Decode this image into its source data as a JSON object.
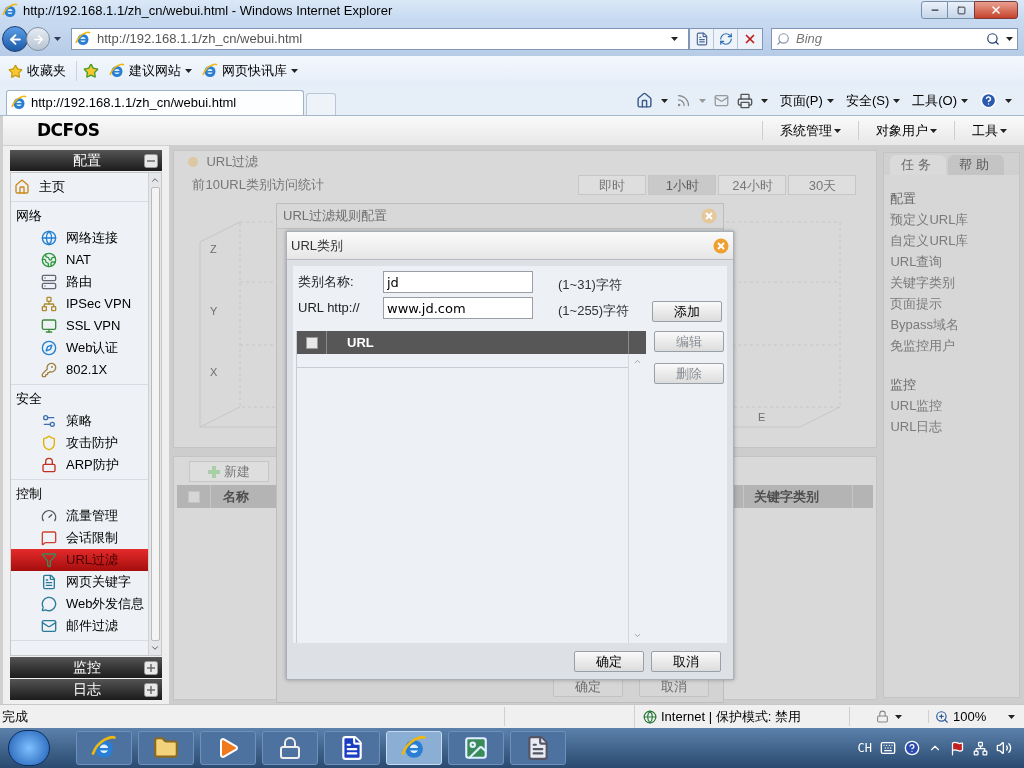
{
  "browser": {
    "title": "http://192.168.1.1/zh_cn/webui.html - Windows Internet Explorer",
    "address": "http://192.168.1.1/zh_cn/webui.html",
    "search_placeholder": "Bing",
    "favorites_label": "收藏夹",
    "favorites": [
      "建议网站",
      "网页快讯库"
    ],
    "tabs": [
      {
        "label": "http://192.168.1.1/zh_cn/webui.html",
        "selected": true
      }
    ],
    "commands": [
      "页面(P)",
      "安全(S)",
      "工具(O)"
    ]
  },
  "app": {
    "logo": "DCFOS",
    "menu": [
      "系统管理",
      "对象用户",
      "工具"
    ]
  },
  "sidebar": {
    "sections": [
      {
        "title": "配置",
        "expanded": true,
        "groups": [
          {
            "items": [
              {
                "label": "主页",
                "selected": false
              }
            ]
          },
          {
            "heading": "网络",
            "items": [
              {
                "label": "网络连接",
                "selected": false
              },
              {
                "label": "NAT",
                "selected": false
              },
              {
                "label": "路由",
                "selected": false
              },
              {
                "label": "IPSec VPN",
                "selected": false
              },
              {
                "label": "SSL VPN",
                "selected": false
              },
              {
                "label": "Web认证",
                "selected": false
              },
              {
                "label": "802.1X",
                "selected": false
              }
            ]
          },
          {
            "heading": "安全",
            "items": [
              {
                "label": "策略",
                "selected": false
              },
              {
                "label": "攻击防护",
                "selected": false
              },
              {
                "label": "ARP防护",
                "selected": false
              }
            ]
          },
          {
            "heading": "控制",
            "items": [
              {
                "label": "流量管理",
                "selected": false
              },
              {
                "label": "会话限制",
                "selected": false
              },
              {
                "label": "URL过滤",
                "selected": true
              },
              {
                "label": "网页关键字",
                "selected": false
              },
              {
                "label": "Web外发信息",
                "selected": false
              },
              {
                "label": "邮件过滤",
                "selected": false
              }
            ]
          }
        ]
      },
      {
        "title": "监控",
        "expanded": false
      },
      {
        "title": "日志",
        "expanded": false
      }
    ]
  },
  "main": {
    "title": "URL过滤",
    "subtitle": "前10URL类别访问统计",
    "range_tabs": [
      {
        "label": "即时",
        "selected": false
      },
      {
        "label": "1小时",
        "selected": true
      },
      {
        "label": "24小时",
        "selected": false
      },
      {
        "label": "30天",
        "selected": false
      }
    ],
    "chart_axes": [
      "Z",
      "Y",
      "X",
      "E"
    ],
    "new_button": "新建",
    "table_columns": [
      "名称",
      "关键字类别"
    ],
    "table_checked": false
  },
  "task_panel": {
    "tabs": [
      {
        "label": "任务",
        "selected": true
      },
      {
        "label": "帮助",
        "selected": false
      }
    ],
    "sections": [
      {
        "title": "配置",
        "items": [
          "预定义URL库",
          "自定义URL库",
          "URL查询",
          "关键字类别",
          "页面提示",
          "Bypass域名",
          "免监控用户"
        ]
      },
      {
        "title": "监控",
        "items": [
          "URL监控",
          "URL日志"
        ]
      }
    ]
  },
  "rule_dialog": {
    "title": "URL过滤规则配置",
    "buttons": [
      "确定",
      "取消"
    ]
  },
  "category_dialog": {
    "title": "URL类别",
    "fields": [
      {
        "label": "类别名称:",
        "value": "jd",
        "hint": "(1~31)字符"
      },
      {
        "label": "URL http://",
        "value": "www.jd.com",
        "hint": "(1~255)字符"
      }
    ],
    "add_button": "添加",
    "columns": [
      "URL"
    ],
    "header_checked": false,
    "side_buttons": [
      {
        "label": "编辑",
        "disabled": true
      },
      {
        "label": "删除",
        "disabled": true
      }
    ],
    "buttons": [
      "确定",
      "取消"
    ]
  },
  "status_bar": {
    "text": "完成",
    "zone": "Internet | 保护模式: 禁用",
    "zoom": "100%"
  },
  "taskbar": {
    "language": "CH"
  }
}
